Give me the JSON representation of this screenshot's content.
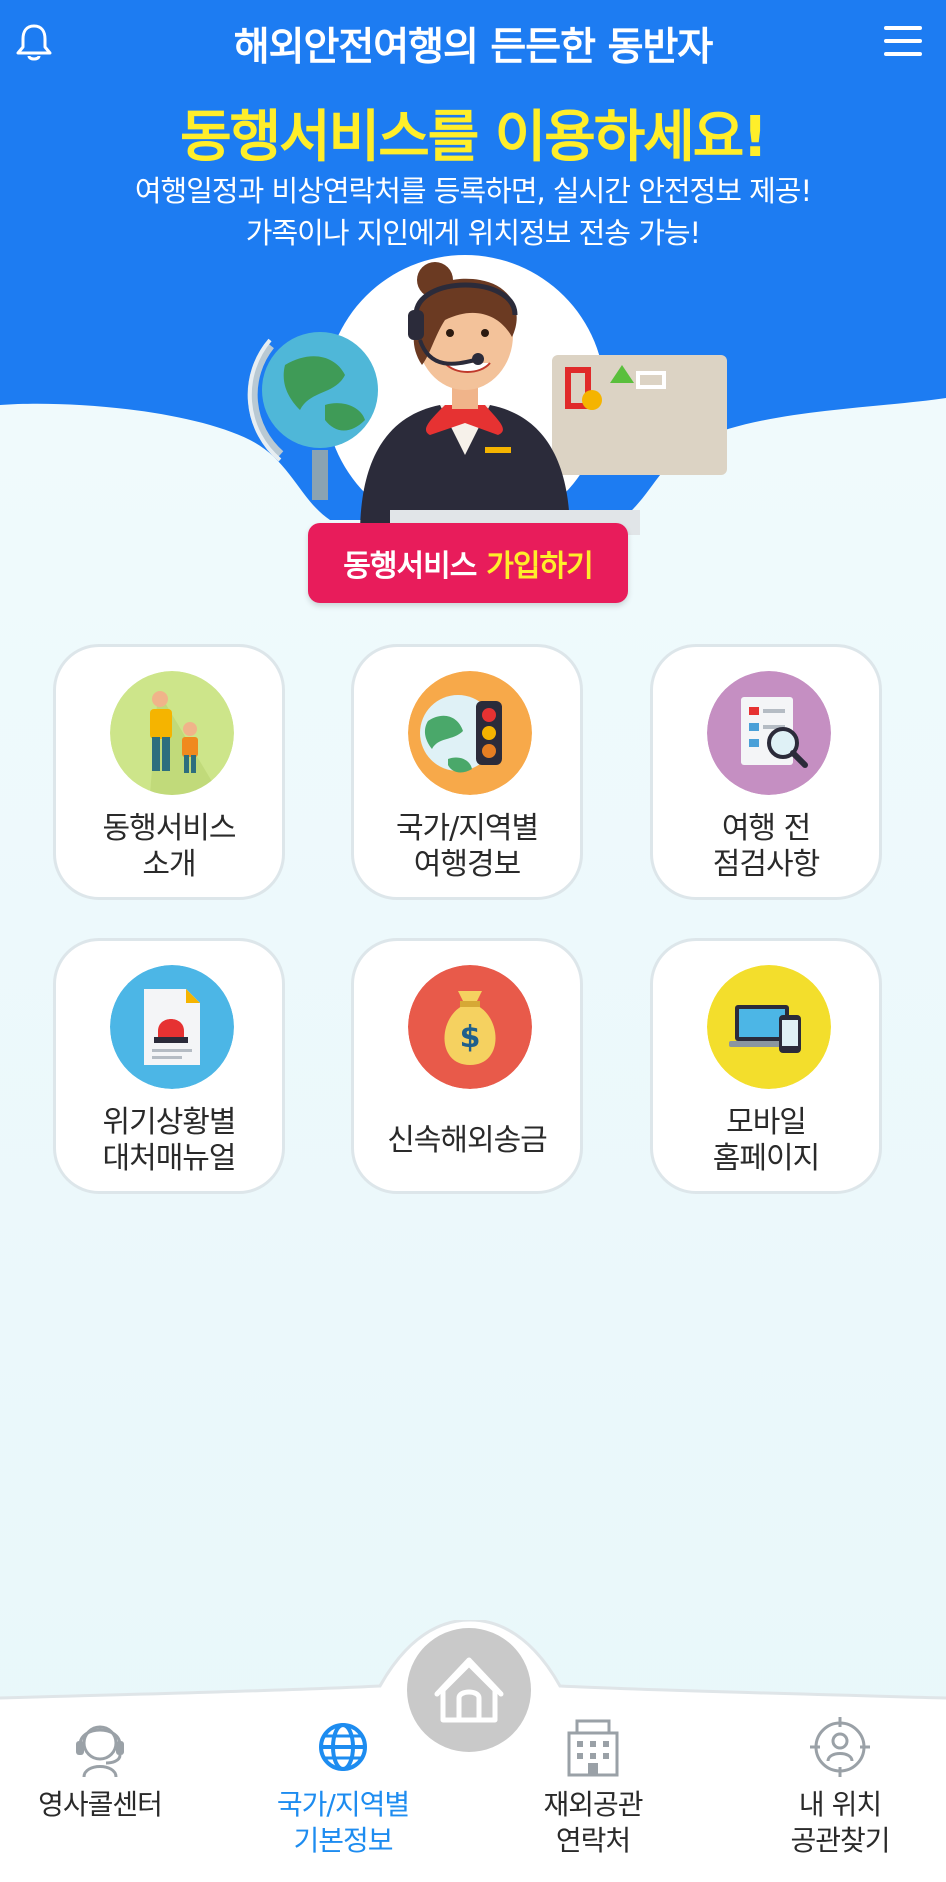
{
  "header": {
    "title": "해외안전여행의 든든한 동반자",
    "bell_icon": "bell-icon",
    "menu_icon": "hamburger-menu-icon"
  },
  "hero": {
    "headline": "동행서비스를 이용하세요!",
    "subtitle_line1": "여행일정과 비상연락처를 등록하면, 실시간 안전정보 제공!",
    "subtitle_line2": "가족이나 지인에게 위치정보 전송 가능!",
    "join_button": {
      "label_main": "동행서비스",
      "label_highlight": "가입하기"
    },
    "colors": {
      "brand_blue": "#1d7cf2",
      "headline_yellow": "#ffee2a",
      "join_pink": "#e81c5b"
    }
  },
  "menu_cards": [
    {
      "line1": "동행서비스",
      "line2": "소개",
      "icon": "family-travel-icon"
    },
    {
      "line1": "국가/지역별",
      "line2": "여행경보",
      "icon": "traffic-light-globe-icon"
    },
    {
      "line1": "여행 전",
      "line2": "점검사항",
      "icon": "checklist-magnifier-icon"
    },
    {
      "line1": "위기상황별",
      "line2": "대처매뉴얼",
      "icon": "alarm-document-icon"
    },
    {
      "line1": "신속해외송금",
      "line2": "",
      "icon": "money-bag-icon"
    },
    {
      "line1": "모바일",
      "line2": "홈페이지",
      "icon": "laptop-phone-icon"
    }
  ],
  "bottom_nav": {
    "home_icon": "home-icon",
    "items": [
      {
        "line1": "영사콜센터",
        "line2": "",
        "icon": "headset-agent-icon",
        "active": false
      },
      {
        "line1": "국가/지역별",
        "line2": "기본정보",
        "icon": "globe-icon",
        "active": true
      },
      {
        "line1": "재외공관",
        "line2": "연락처",
        "icon": "building-icon",
        "active": false
      },
      {
        "line1": "내 위치",
        "line2": "공관찾기",
        "icon": "location-target-icon",
        "active": false
      }
    ],
    "active_color": "#1d8cf0"
  }
}
